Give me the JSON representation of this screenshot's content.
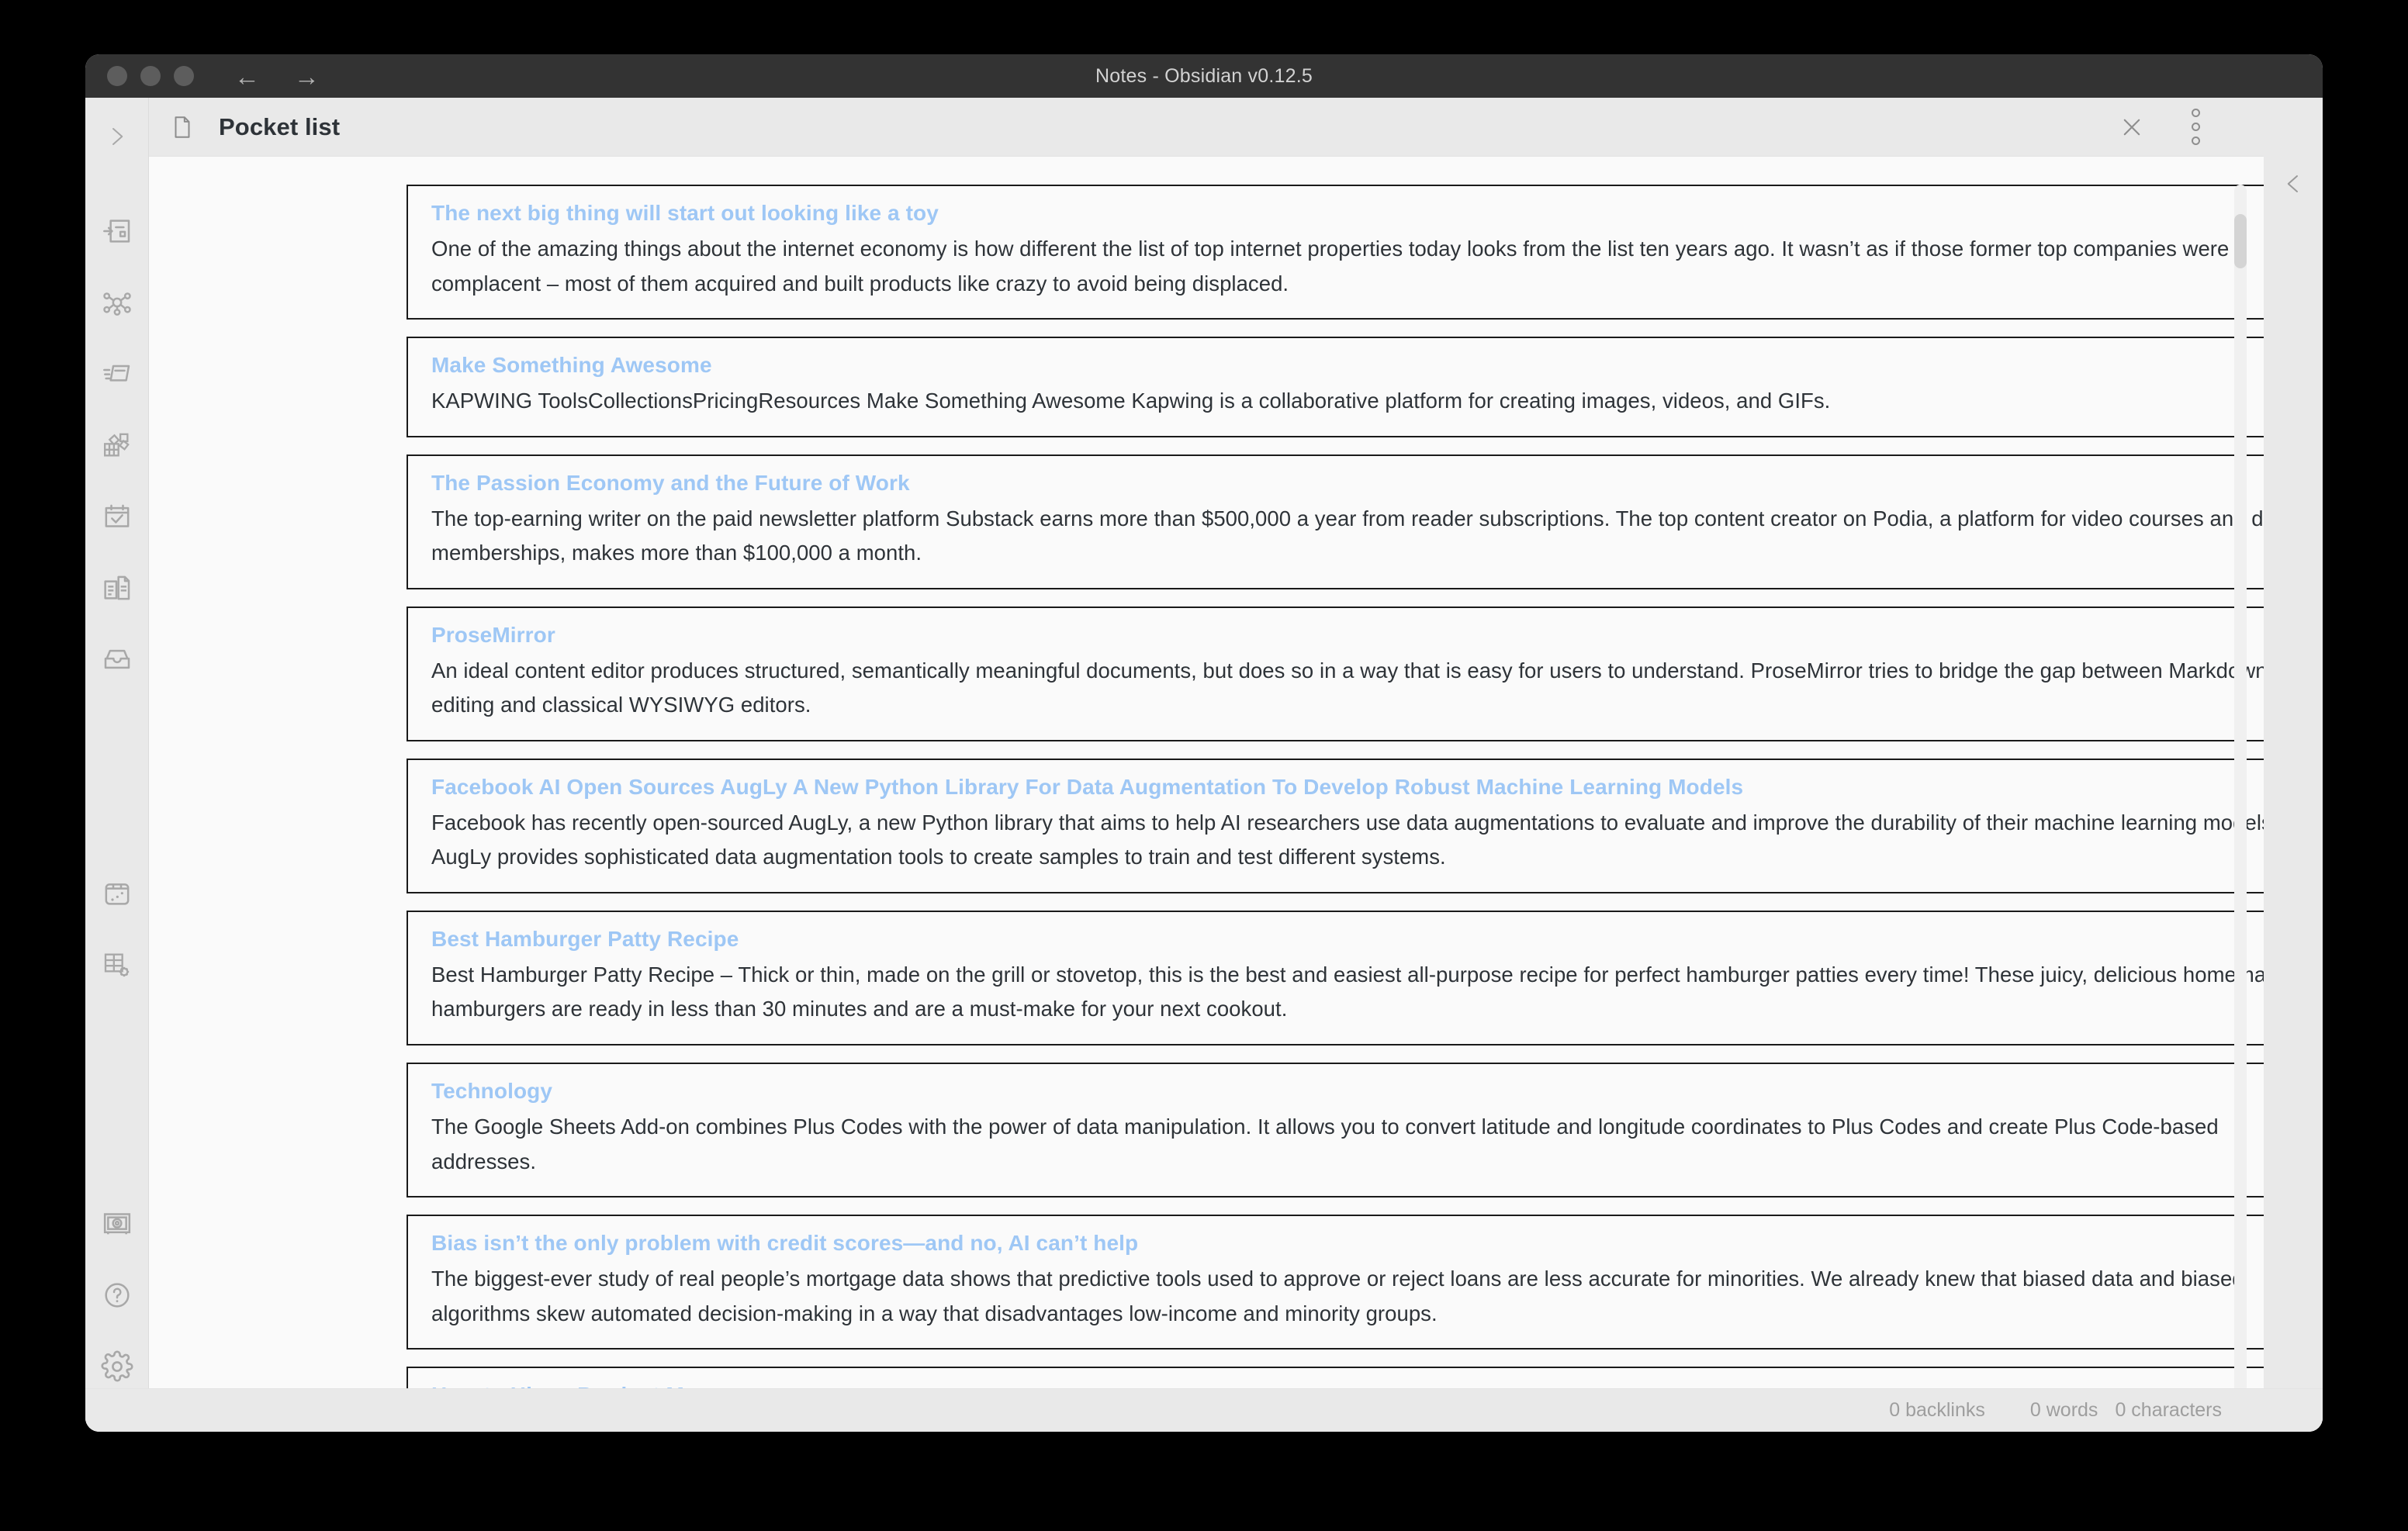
{
  "window": {
    "title": "Notes - Obsidian v0.12.5",
    "nav": {
      "back": "←",
      "forward": "→"
    }
  },
  "ribbon": {
    "collapse_label": "›",
    "items": [
      {
        "name": "expand-sidebar-icon",
        "label": "Expand sidebar"
      },
      {
        "name": "open-note-icon",
        "label": "Open note"
      },
      {
        "name": "graph-view-icon",
        "label": "Open graph view"
      },
      {
        "name": "quick-switcher-icon",
        "label": "Quick switcher"
      },
      {
        "name": "canvas-icon",
        "label": "Canvas"
      },
      {
        "name": "calendar-icon",
        "label": "Calendar"
      },
      {
        "name": "templates-icon",
        "label": "Templates"
      },
      {
        "name": "archive-icon",
        "label": "Archive"
      },
      {
        "name": "random-note-icon",
        "label": "Random note"
      },
      {
        "name": "table-settings-icon",
        "label": "Table settings"
      },
      {
        "name": "vault-icon",
        "label": "Vault"
      },
      {
        "name": "help-icon",
        "label": "Help"
      },
      {
        "name": "settings-icon",
        "label": "Settings"
      }
    ]
  },
  "tab": {
    "title": "Pocket list",
    "doc_icon": "document-icon",
    "close_label": "×",
    "menu_label": "More options"
  },
  "right_rail": {
    "collapse_label": "‹"
  },
  "notes": [
    {
      "title": "The next big thing will start out looking like a toy",
      "body": "One of the amazing things about the internet economy is how different the list of top internet properties today looks from the list ten years ago.  It wasn’t as if those former top companies were complacent – most of them acquired and built products like crazy to avoid being displaced."
    },
    {
      "title": "Make Something Awesome",
      "body": "KAPWING ToolsCollectionsPricingResources Make Something Awesome Kapwing is a collaborative platform for creating images, videos, and GIFs."
    },
    {
      "title": "The Passion Economy and the Future of Work",
      "body": "The top-earning writer on the paid newsletter platform Substack earns more than $500,000 a year from reader subscriptions. The top content creator on Podia, a platform for video courses and digital memberships, makes more than $100,000 a month."
    },
    {
      "title": "ProseMirror",
      "body": "An ideal content editor produces structured, semantically meaningful documents, but does so in a way that is easy for users to understand. ProseMirror tries to bridge the gap between Markdown text editing and classical WYSIWYG editors."
    },
    {
      "title": "Facebook AI Open Sources AugLy A New Python Library For Data Augmentation To Develop Robust Machine Learning Models",
      "body": "Facebook has recently open-sourced AugLy, a new Python library that aims to help AI researchers use data augmentations to evaluate and improve the durability of their machine learning models. AugLy provides sophisticated data augmentation tools to create samples to train and test different systems."
    },
    {
      "title": "Best Hamburger Patty Recipe",
      "body": "Best Hamburger Patty Recipe – Thick or thin, made on the grill or stovetop, this is the best and easiest all-purpose recipe for perfect hamburger patties every time! These juicy, delicious homemade hamburgers are ready in less than 30 minutes and are a must-make for your next cookout."
    },
    {
      "title": "Technology",
      "body": "The Google Sheets Add-on combines Plus Codes with the power of data manipulation. It allows you to convert latitude and longitude coordinates to Plus Codes and create Plus Code-based addresses."
    },
    {
      "title": "Bias isn’t the only problem with credit scores—and no, AI can’t help",
      "body": "The biggest-ever study of real people’s mortgage data shows that predictive tools used to approve or reject loans are less accurate for minorities. We already knew that biased data and biased algorithms skew automated decision-making in a way that disadvantages low-income and minority groups."
    },
    {
      "title": "How to Hire a Product Manager",
      "body": ""
    }
  ],
  "statusbar": {
    "backlinks": "0 backlinks",
    "words": "0 words",
    "characters": "0 characters"
  },
  "colors": {
    "link": "#9ec7f5",
    "text": "#2e3338",
    "titlebar": "#333333",
    "chrome": "#e9e9e9",
    "note_bg": "#fafafa"
  }
}
